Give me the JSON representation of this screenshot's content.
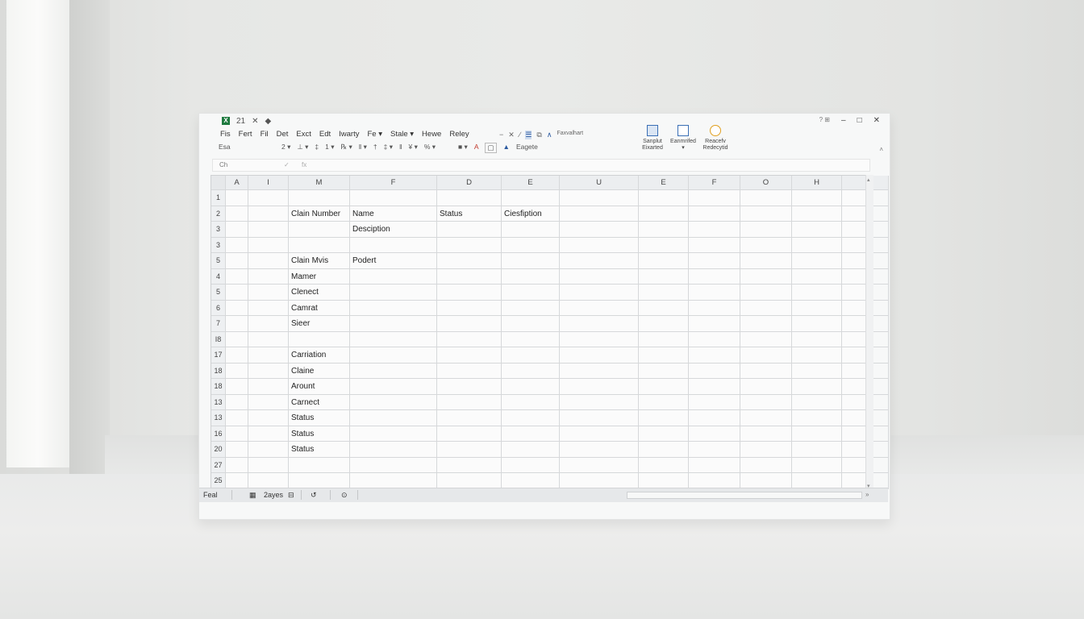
{
  "titlebar": {
    "app_icon": "X",
    "quick_icons": [
      "21",
      "✕",
      "◆"
    ],
    "controls": [
      "–",
      "□",
      "✕"
    ],
    "help": "? ⊞"
  },
  "menu": [
    "Fis",
    "Fert",
    "Fil",
    "Det",
    "Exct",
    "Edt",
    "Iwarty",
    "Fe ▾",
    "Stale ▾",
    "Hewe",
    "Reley"
  ],
  "ribbon": {
    "small_row": [
      "Esa",
      "2 ▾",
      "⊥ ▾",
      "‡",
      "1 ▾",
      "℞ ▾",
      "‖ ▾",
      "†",
      "‡ ▾",
      "‖",
      "¥ ▾",
      "% ▾"
    ],
    "tool_row": [
      "−",
      "✕",
      "∕",
      "☰",
      "⧉",
      "∧"
    ],
    "styles_label": "Faxvalhart",
    "styles_sub": "Eagete",
    "groups": [
      {
        "label1": "Sanplut",
        "label2": "Eixarted"
      },
      {
        "label1": "Eanmrifed",
        "label2": "▾"
      },
      {
        "label1": "Reacefv",
        "label2": "Redecytid"
      }
    ],
    "collapse": "˄"
  },
  "formula_bar": {
    "name_box": "Ch",
    "fx1": "✓",
    "fx2": "fx"
  },
  "columns": [
    "A",
    "I",
    "M",
    "F",
    "D",
    "E",
    "U",
    "E",
    "F",
    "O",
    "H",
    ""
  ],
  "rows": [
    {
      "num": "1",
      "cells": [
        "",
        "",
        "",
        "",
        "",
        "",
        "",
        "",
        "",
        "",
        "",
        ""
      ]
    },
    {
      "num": "2",
      "cells": [
        "",
        "",
        "Clain Number",
        "Name",
        "Status",
        "Ciesfiption",
        "",
        "",
        "",
        "",
        "",
        ""
      ]
    },
    {
      "num": "3",
      "cells": [
        "",
        "",
        "",
        "Desciption",
        "",
        "",
        "",
        "",
        "",
        "",
        "",
        ""
      ]
    },
    {
      "num": "3",
      "cells": [
        "",
        "",
        "",
        "",
        "",
        "",
        "",
        "",
        "",
        "",
        "",
        ""
      ]
    },
    {
      "num": "5",
      "cells": [
        "",
        "",
        "Clain Mvis",
        "Podert",
        "",
        "",
        "",
        "",
        "",
        "",
        "",
        ""
      ]
    },
    {
      "num": "4",
      "cells": [
        "",
        "",
        "Mamer",
        "",
        "",
        "",
        "",
        "",
        "",
        "",
        "",
        ""
      ]
    },
    {
      "num": "5",
      "cells": [
        "",
        "",
        "Clenect",
        "",
        "",
        "",
        "",
        "",
        "",
        "",
        "",
        ""
      ]
    },
    {
      "num": "6",
      "cells": [
        "",
        "",
        "Camrat",
        "",
        "",
        "",
        "",
        "",
        "",
        "",
        "",
        ""
      ]
    },
    {
      "num": "7",
      "cells": [
        "",
        "",
        "Sieer",
        "",
        "",
        "",
        "",
        "",
        "",
        "",
        "",
        ""
      ]
    },
    {
      "num": "I8",
      "cells": [
        "",
        "",
        "",
        "",
        "",
        "",
        "",
        "",
        "",
        "",
        "",
        ""
      ]
    },
    {
      "num": "17",
      "cells": [
        "",
        "",
        "Carriation",
        "",
        "",
        "",
        "",
        "",
        "",
        "",
        "",
        ""
      ]
    },
    {
      "num": "18",
      "cells": [
        "",
        "",
        "Claine",
        "",
        "",
        "",
        "",
        "",
        "",
        "",
        "",
        ""
      ]
    },
    {
      "num": "18",
      "cells": [
        "",
        "",
        "Arount",
        "",
        "",
        "",
        "",
        "",
        "",
        "",
        "",
        ""
      ]
    },
    {
      "num": "13",
      "cells": [
        "",
        "",
        "Carnect",
        "",
        "",
        "",
        "",
        "",
        "",
        "",
        "",
        ""
      ]
    },
    {
      "num": "13",
      "cells": [
        "",
        "",
        "Status",
        "",
        "",
        "",
        "",
        "",
        "",
        "",
        "",
        ""
      ]
    },
    {
      "num": "16",
      "cells": [
        "",
        "",
        "Status",
        "",
        "",
        "",
        "",
        "",
        "",
        "",
        "",
        ""
      ]
    },
    {
      "num": "20",
      "cells": [
        "",
        "",
        "Status",
        "",
        "",
        "",
        "",
        "",
        "",
        "",
        "",
        ""
      ]
    },
    {
      "num": "27",
      "cells": [
        "",
        "",
        "",
        "",
        "",
        "",
        "",
        "",
        "",
        "",
        "",
        ""
      ]
    },
    {
      "num": "25",
      "cells": [
        "",
        "",
        "",
        "",
        "",
        "",
        "",
        "",
        "",
        "",
        "",
        ""
      ]
    }
  ],
  "statusbar": {
    "ready": "Feal",
    "sheet_icon": "▦",
    "sheet_count": "2ayes",
    "grid_icon": "⊟",
    "undo_icon": "↺",
    "zoom_icon": "⊙",
    "hs_arrow": "»"
  }
}
